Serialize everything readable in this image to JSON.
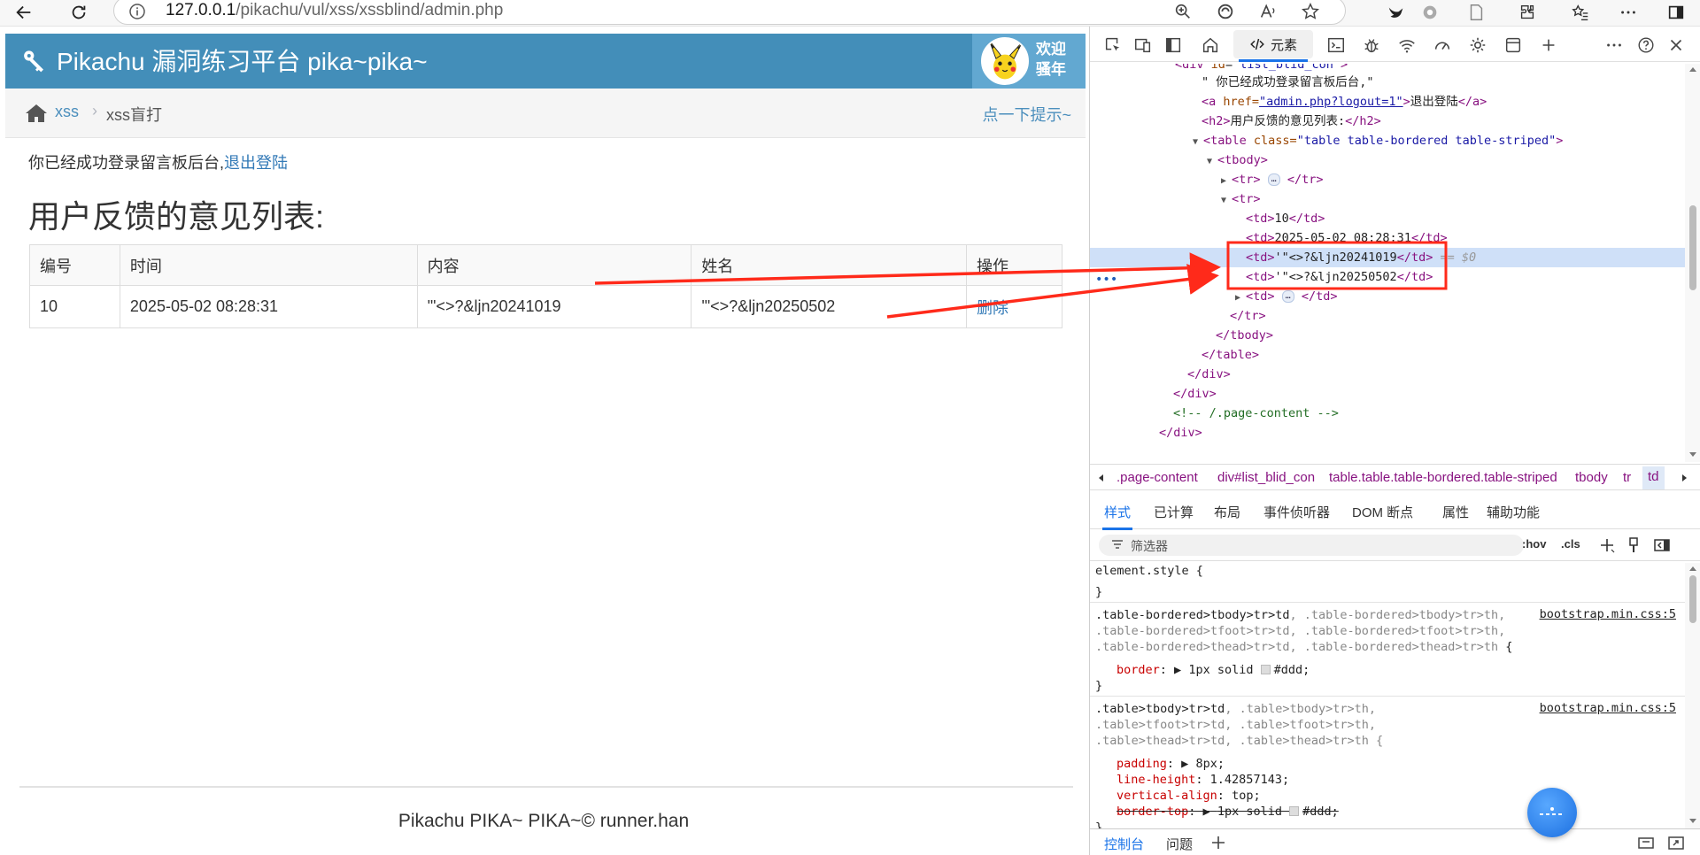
{
  "browser": {
    "url_host": "127.0.0.1",
    "url_path": "/pikachu/vul/xss/xssblind/admin.php"
  },
  "app": {
    "brand": "Pikachu 漏洞练习平台 pika~pika~",
    "welcome_line1": "欢迎",
    "welcome_line2": "骚年"
  },
  "breadcrumb": {
    "section": "xss",
    "separator": "›",
    "current": "xss盲打",
    "hint_link": "点一下提示~"
  },
  "main": {
    "login_message": "你已经成功登录留言板后台,",
    "logout_link": "退出登陆",
    "list_title": "用户反馈的意见列表:",
    "table": {
      "headers": [
        "编号",
        "时间",
        "内容",
        "姓名",
        "操作"
      ],
      "rows": [
        [
          "10",
          "2025-05-02 08:28:31",
          "'\"<>?&ljn20241019",
          "'\"<>?&ljn20250502",
          "删除"
        ]
      ]
    }
  },
  "footer": {
    "text": "Pikachu PIKA~ PIKA~© runner.han"
  },
  "devtools": {
    "elements_tab": "元素",
    "dom": {
      "l0_tag": "div",
      "l0_attr": "id",
      "l0_val": "\"list_blid_con\"",
      "l1_text": "\" 你已经成功登录留言板后台,\"",
      "l2_open": "<a ",
      "l2_attr": "href=",
      "l2_val": "\"admin.php?logout=1\"",
      "l2_close": ">",
      "l2_text": "退出登陆",
      "l2_end": "</a>",
      "l3_open": "<h2>",
      "l3_text": "用户反馈的意见列表:",
      "l3_end": "</h2>",
      "l4_open": "<table ",
      "l4_attr": "class=",
      "l4_val": "\"table table-bordered table-striped\"",
      "l4_close": ">",
      "l5": "<tbody>",
      "l6_open": "<tr>",
      "l6_ell": "…",
      "l6_end": "</tr>",
      "l7": "<tr>",
      "l8_open": "<td>",
      "l8_text": "10",
      "l8_end": "</td>",
      "l9_open": "<td>",
      "l9_text": "2025-05-02 08:28:31",
      "l9_end": "</td>",
      "l10_open": "<td>",
      "l10_text": "'\"<>?&ljn20241019",
      "l10_end": "</td>",
      "l10_eq": "== $0",
      "l11_open": "<td>",
      "l11_text": "'\"<>?&ljn20250502",
      "l11_end": "</td>",
      "l12_open": "<td>",
      "l12_ell": "…",
      "l12_end": "</td>",
      "l13": "</tr>",
      "l14": "</tbody>",
      "l15": "</table>",
      "l16": "</div>",
      "l17": "</div>",
      "l18": "<!-- /.page-content -->",
      "l19": "</div>",
      "sel_dots": "•••"
    },
    "crumbs": [
      ".page-content",
      "div#list_blid_con",
      "table.table.table-bordered.table-striped",
      "tbody",
      "tr",
      "td"
    ],
    "style_tabs": [
      "样式",
      "已计算",
      "布局",
      "事件侦听器",
      "DOM 断点",
      "属性",
      "辅助功能"
    ],
    "filter_placeholder": "筛选器",
    "hov": ":hov",
    "cls": ".cls",
    "styles": {
      "element_style_open": "element.style {",
      "close": "}",
      "r1_s1a": ".table-bordered>tbody>tr>td",
      "r1_s1b": ", .table-bordered>tbody>tr>th,",
      "r1_s2": ".table-bordered>tfoot>tr>td, .table-bordered>tfoot>tr>th,",
      "r1_s3a": ".table-bordered>thead>tr>td, .table-bordered>thead>tr>th",
      "r1_s3b": " {",
      "r1_src": "bootstrap.min.css:5",
      "r1_prop": "border",
      "r1_val": "1px solid",
      "r1_color": "#ddd;",
      "r2_s1a": ".table>tbody>tr>td",
      "r2_s1b": ", .table>tbody>tr>th,",
      "r2_s2": ".table>tfoot>tr>td, .table>tfoot>tr>th,",
      "r2_s3": ".table>thead>tr>td, .table>thead>tr>th {",
      "r2_src": "bootstrap.min.css:5",
      "r2_p1": "padding",
      "r2_v1": "8px;",
      "r2_p2": "line-height",
      "r2_v2": "1.42857143;",
      "r2_p3": "vertical-align",
      "r2_v3": "top;",
      "r2_p4": "border-top",
      "r2_v4": "1px solid",
      "r2_v4c": "#ddd;"
    },
    "drawer_tabs": [
      "控制台",
      "问题"
    ]
  },
  "colors": {
    "navbar": "#438eb9",
    "user_area": "#62a8d1",
    "annotation_red": "#ff2a1a"
  }
}
